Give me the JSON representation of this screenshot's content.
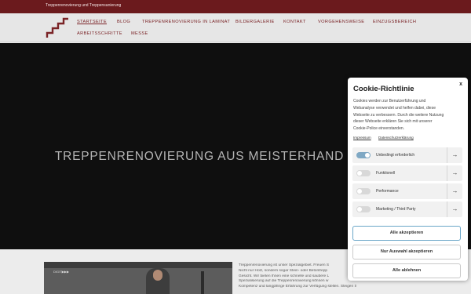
{
  "topbar": {
    "text": "Treppenrenovierung und Treppensanierung"
  },
  "nav": {
    "items": [
      {
        "label": "Startseite"
      },
      {
        "label": "Blog"
      },
      {
        "label": "Treppenrenovierung in Laminat"
      },
      {
        "label": "Bildergalerie"
      },
      {
        "label": "Kontakt"
      },
      {
        "label": "Vorgehensweise"
      },
      {
        "label": "Einzugsbereich"
      },
      {
        "label": "Arbeitsschritte"
      },
      {
        "label": "Messe"
      }
    ]
  },
  "hero": {
    "headline": "TREPPENRENOVIERUNG AUS MEISTERHAND"
  },
  "content": {
    "video_label": "DIGIT▶▶▶",
    "lines": [
      "Treppenrenovierung ist unser Spezialgebiet. Freuen S",
      "Nicht nur Holz, sondern sogar Stein- oder Betontrepp",
      "Gesicht. Wir bieten Ihnen eine schnelle und saubere L",
      "Spezialisierung auf die Treppenrenovierung können w",
      "Kompetenz und langjährige Erfahrung zur Verfügung stellen. Steigen Sie, wie innerhalb"
    ]
  },
  "cookie": {
    "title": "Cookie-Richtlinie",
    "close": "x",
    "description": [
      "Cookies werden zur Benutzerführung und",
      "Webanalyse verwendet und helfen dabei, diese",
      "Webseite zu verbessern. Durch die weitere Nutzung",
      "dieser Webseite erklären Sie sich mit unserer",
      "Cookie-Police einverstanden."
    ],
    "links": {
      "impressum": "Impressum",
      "datenschutz": "Datenschutzerklärung"
    },
    "options": [
      {
        "label": "Unbedingt erforderlich",
        "enabled": true
      },
      {
        "label": "Funktionell",
        "enabled": false
      },
      {
        "label": "Performance",
        "enabled": false
      },
      {
        "label": "Marketing / Third Party",
        "enabled": false
      }
    ],
    "arrow": "→",
    "buttons": {
      "accept_all": "Alle akzeptieren",
      "accept_selection": "Nur Auswahl akzeptieren",
      "reject_all": "Alle ablehnen"
    }
  },
  "colors": {
    "brand": "#6b1a1d",
    "accent": "#6aa6c8"
  }
}
